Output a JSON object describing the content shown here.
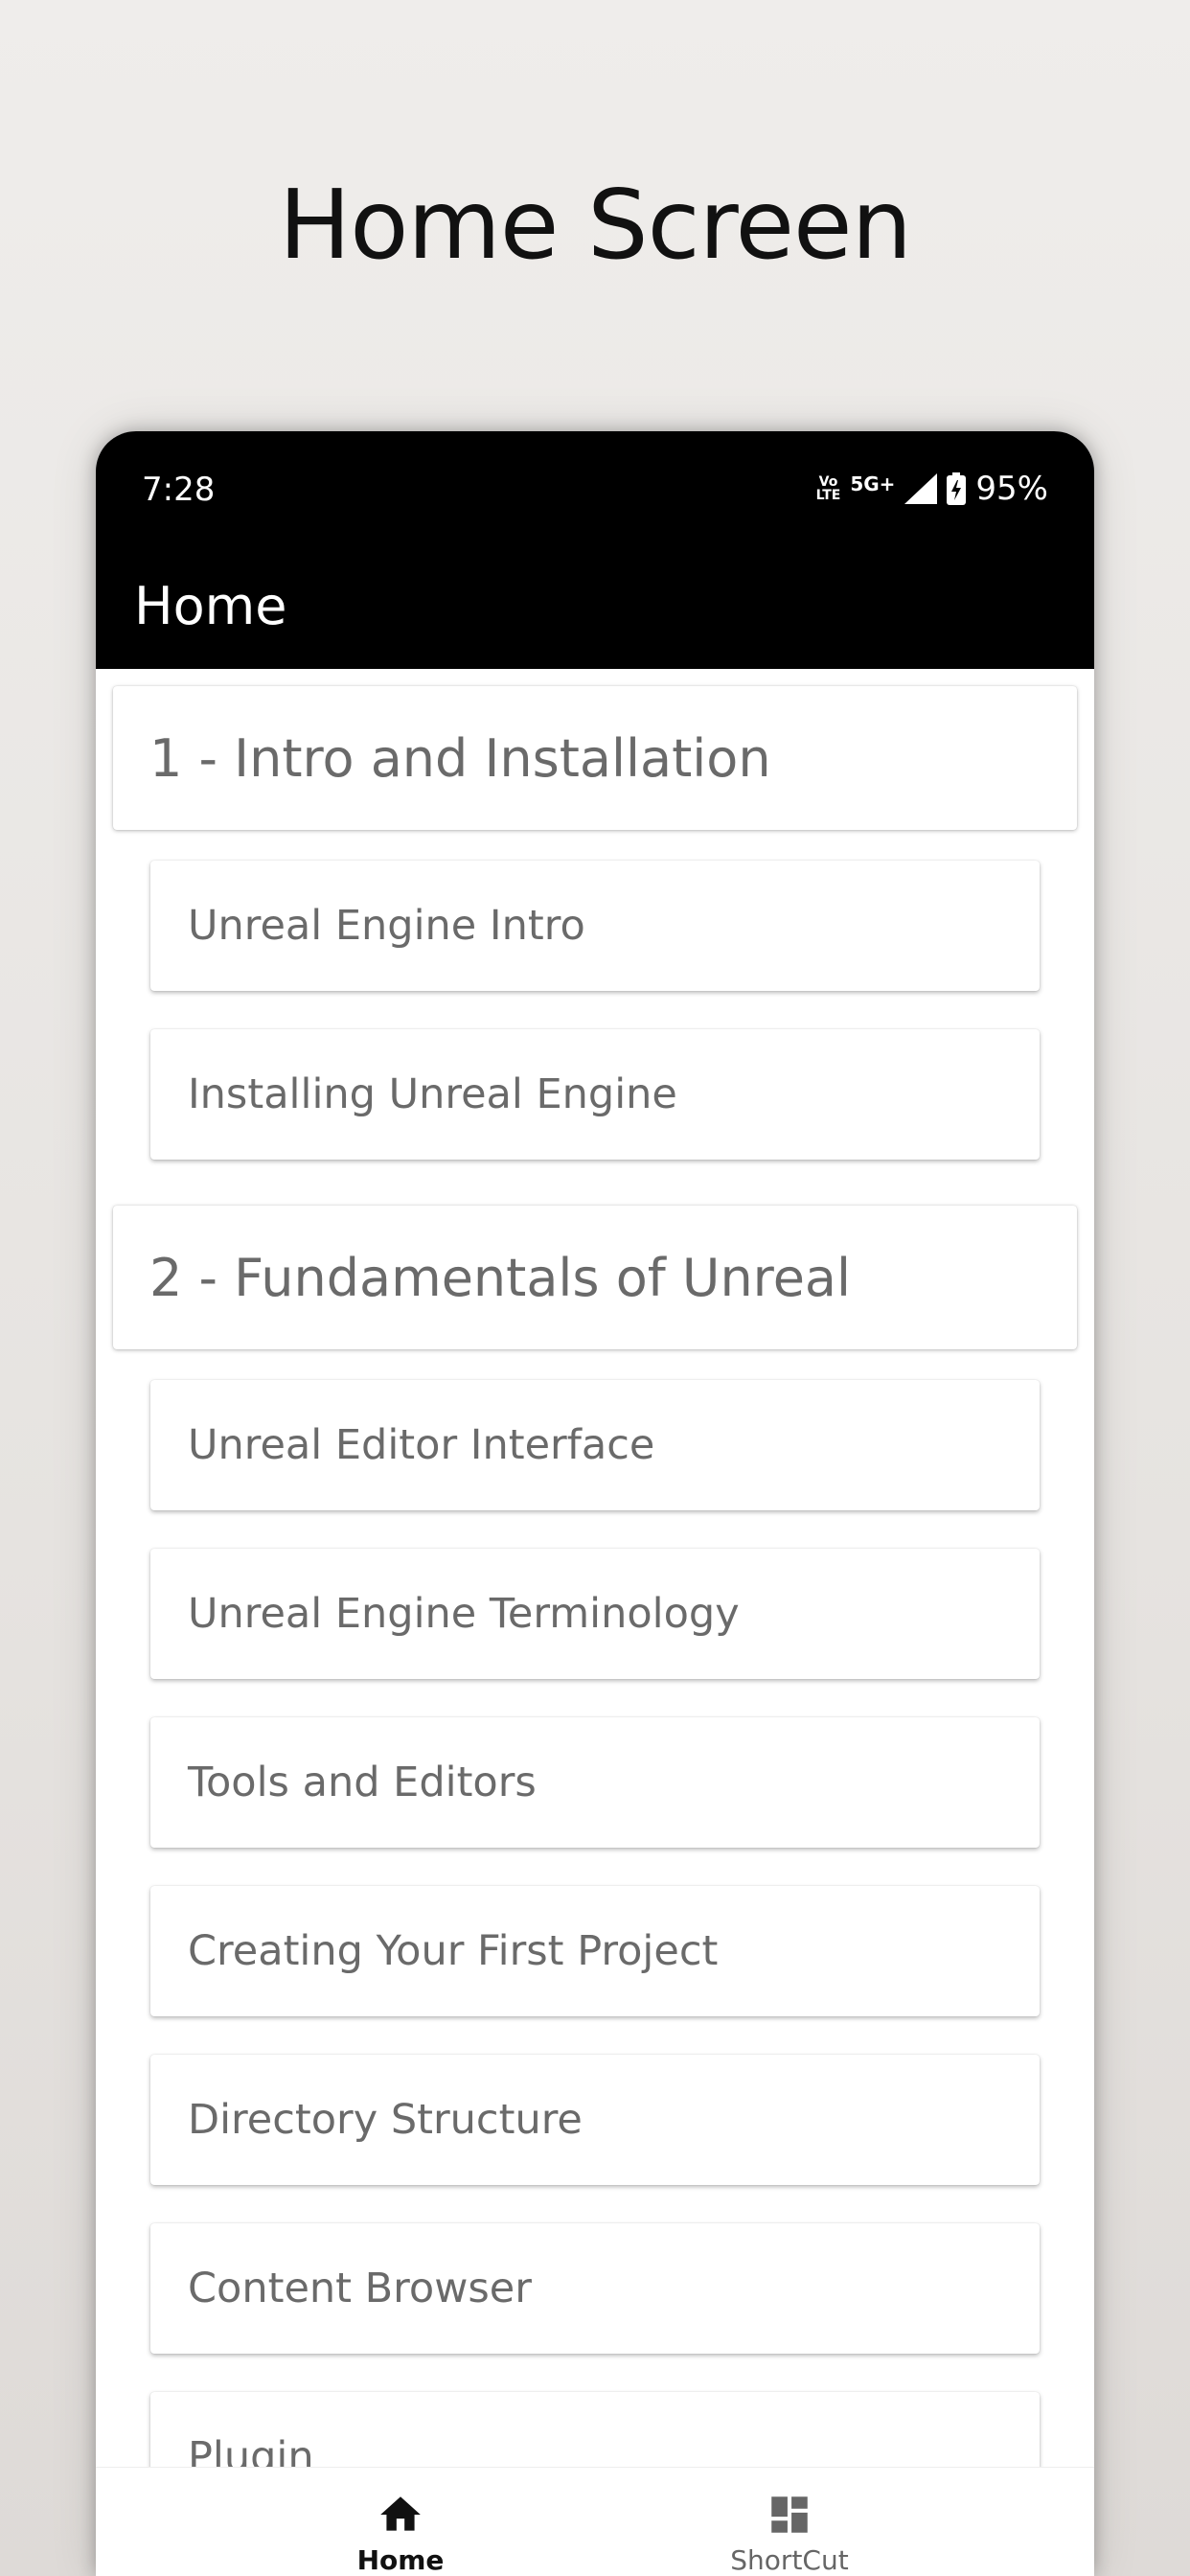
{
  "page": {
    "heading": "Home Screen"
  },
  "status_bar": {
    "time": "7:28",
    "volte_top": "Vo",
    "volte_bottom": "LTE",
    "network": "5G+",
    "battery": "95%"
  },
  "app_bar": {
    "title": "Home"
  },
  "sections": [
    {
      "title": "1 - Intro and Installation",
      "items": [
        "Unreal Engine Intro",
        "Installing Unreal Engine"
      ]
    },
    {
      "title": "2 - Fundamentals of Unreal",
      "items": [
        "Unreal Editor Interface",
        "Unreal Engine Terminology",
        "Tools and Editors",
        "Creating Your First Project",
        "Directory Structure",
        "Content Browser",
        "Plugin"
      ]
    }
  ],
  "bottom_nav": {
    "items": [
      {
        "label": "Home",
        "icon": "home-icon",
        "active": true
      },
      {
        "label": "ShortCut",
        "icon": "dashboard-icon",
        "active": false
      }
    ]
  },
  "colors": {
    "app_bar": "#000000",
    "card_text": "#6a6a6a",
    "active_nav": "#111111",
    "inactive_nav": "#666666"
  }
}
